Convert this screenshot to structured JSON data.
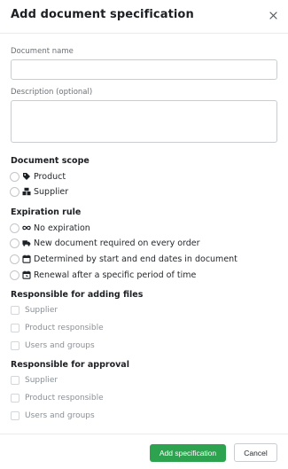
{
  "dialog": {
    "title": "Add document specification"
  },
  "fields": {
    "document_name_label": "Document name",
    "document_name_value": "",
    "description_label": "Description (optional)",
    "description_value": ""
  },
  "document_scope": {
    "title": "Document scope",
    "options": [
      {
        "label": "Product",
        "icon": "tag-icon"
      },
      {
        "label": "Supplier",
        "icon": "supplier-icon"
      }
    ]
  },
  "expiration_rule": {
    "title": "Expiration rule",
    "options": [
      {
        "label": "No expiration",
        "icon": "infinity-icon"
      },
      {
        "label": "New document required on every order",
        "icon": "truck-icon"
      },
      {
        "label": "Determined by start and end dates in document",
        "icon": "calendar-icon"
      },
      {
        "label": "Renewal after a specific period of time",
        "icon": "calendar-clock-icon"
      }
    ]
  },
  "responsible_adding": {
    "title": "Responsible for adding files",
    "options": [
      "Supplier",
      "Product responsible",
      "Users and groups"
    ]
  },
  "responsible_approval": {
    "title": "Responsible for approval",
    "options": [
      "Supplier",
      "Product responsible",
      "Users and groups"
    ]
  },
  "footer": {
    "primary_label": "Add specification",
    "cancel_label": "Cancel"
  },
  "colors": {
    "primary": "#2ea34f",
    "border": "#c9ccd0",
    "muted_text": "#8a8f95"
  }
}
